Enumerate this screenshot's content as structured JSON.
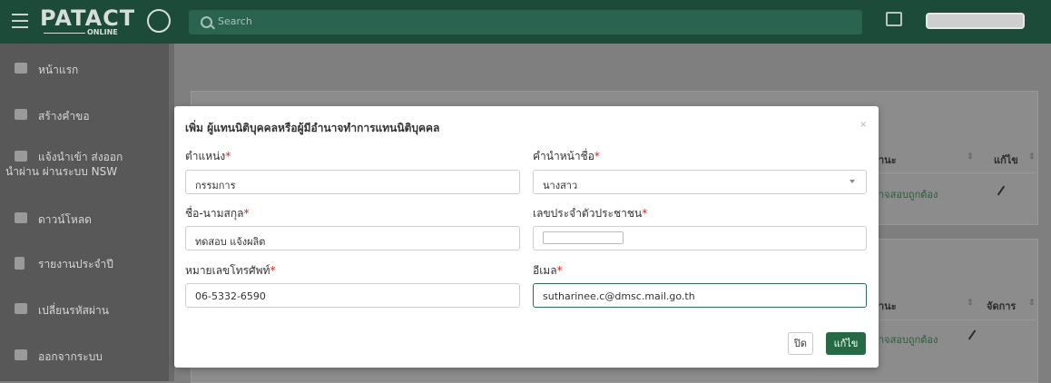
{
  "header": {
    "logo_text": "PATACT",
    "logo_sub": "ONLINE",
    "search_placeholder": "Search"
  },
  "sidebar": {
    "items": [
      {
        "label": "หน้าแรก",
        "icon": "home-icon"
      },
      {
        "label": "สร้างคำขอ",
        "icon": "pencil-icon"
      },
      {
        "label_line1": "แจ้งนำเข้า ส่งออก",
        "label_line2": "นำผ่าน ผ่านระบบ NSW",
        "icon": "plane-icon"
      },
      {
        "label": "ดาวน์โหลด",
        "icon": "download-icon"
      },
      {
        "label": "รายงานประจำปี",
        "icon": "document-icon"
      },
      {
        "label": "เปลี่ยนรหัสผ่าน",
        "icon": "gears-icon"
      },
      {
        "label": "ออกจากระบบ",
        "icon": "logout-icon"
      }
    ]
  },
  "background": {
    "col_status_1": "านะ",
    "col_edit_1": "แก้ไข",
    "status_1": "าจสอบถูกต้อง",
    "col_status_2": "านะ",
    "col_manage_2": "จัดการ",
    "status_2": "าจสอบถูกต้อง"
  },
  "modal": {
    "title": "เพิ่ม ผู้แทนนิติบุคคลหรือผู้มีอำนาจทำการแทนนิติบุคคล",
    "close_symbol": "×",
    "position_label": "ตำแหน่ง",
    "position_value": "กรรมการ",
    "prefix_label": "คำนำหน้าชื่อ",
    "prefix_value": "นางสาว",
    "name_label": "ชื่อ-นามสกุล",
    "name_value": "ทดสอบ แจ้งผลิต",
    "idcard_label": "เลขประจำตัวประชาชน",
    "phone_label": "หมายเลขโทรศัพท์",
    "phone_value": "06-5332-6590",
    "email_label": "อีเมล",
    "email_value": "sutharinee.c@dmsc.mail.go.th",
    "required_mark": "*",
    "close_button": "ปิด",
    "edit_button": "แก้ไข"
  },
  "colors": {
    "header_bg": "#1d4b3a",
    "primary_button": "#256a45",
    "required": "#d9261c",
    "overlay": "#7f7f7f"
  }
}
